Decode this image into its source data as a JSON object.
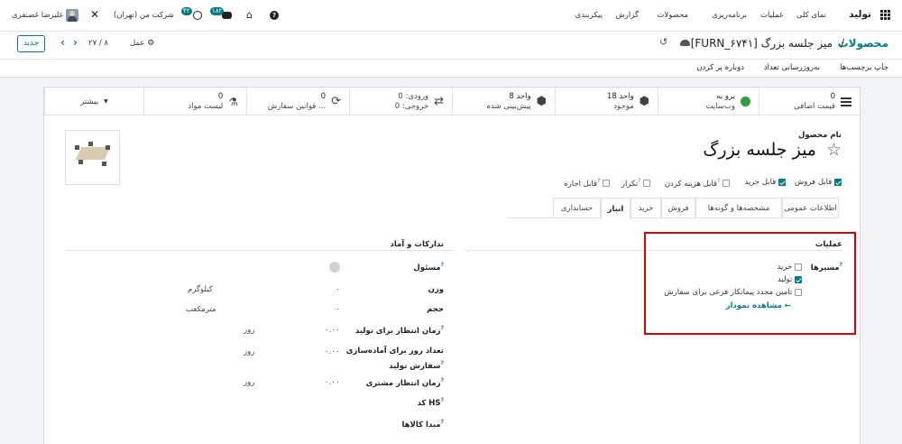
{
  "topnav": {
    "app_name": "تولید",
    "menu": [
      "نمای کلی",
      "عملیات",
      "برنامه‌ریزی",
      "محصولات",
      "گزارش",
      "پیکربندی"
    ],
    "user": "علیرضا غضنفری",
    "company": "شرکت من (تهران)",
    "activity_count": "۴۲",
    "messages_count": "۱۸۲"
  },
  "control_panel": {
    "breadcrumb_parent": "محصولات",
    "breadcrumb_sep": "/",
    "record_title": "[FURN_۶۷۴۱] میز جلسه بزرگ",
    "new_button": "جدید",
    "pager": "۸ / ۲۷",
    "action_label": "عمل"
  },
  "action_bar": {
    "buttons": [
      "چاپ برچسب‌ها",
      "به‌روزرسانی تعداد",
      "دوباره پر کردن"
    ]
  },
  "smart_buttons": [
    {
      "value": "0",
      "label": "قیمت اضافی",
      "icon": "list-icon"
    },
    {
      "value": "برو به",
      "label": "وب‌سایت",
      "icon": "globe-icon"
    },
    {
      "value": "18 واحد",
      "label": "موجود",
      "icon": "cubes-icon"
    },
    {
      "value": "8 واحد",
      "label": "پیش‌بینی شده",
      "icon": "cubes-icon"
    },
    {
      "value": "ورودی:  0",
      "label": "خروجی:  0",
      "icon": "exchange-icon"
    },
    {
      "value": "0",
      "label": "قوانین سفارش ...",
      "icon": "refresh-icon"
    },
    {
      "value": "0",
      "label": "لیست مواد",
      "icon": "flask-icon"
    },
    {
      "value": "",
      "label": "بیشتر",
      "icon": "caret-down-icon"
    }
  ],
  "product": {
    "name_label": "نام محصول",
    "name": "میز جلسه بزرگ",
    "flags": [
      {
        "label": "قابل فروش",
        "checked": true
      },
      {
        "label": "قابل خرید",
        "checked": true
      },
      {
        "label": "قابل هزینه کردن",
        "checked": false
      },
      {
        "label": "تکرار",
        "checked": false
      },
      {
        "label": "قابل اجاره",
        "checked": false
      }
    ]
  },
  "tabs": [
    "اطلاعات عمومی",
    "مشخصه‌ها و گونه‌ها",
    "فروش",
    "خرید",
    "انبار",
    "حسابداری"
  ],
  "operations": {
    "title": "عملیات",
    "routes_label": "مسیرها",
    "routes": [
      {
        "label": "خرید",
        "checked": false
      },
      {
        "label": "تولید",
        "checked": true
      },
      {
        "label": "تامین مجدد پیمانکار فرعی برای سفارش",
        "checked": false
      }
    ],
    "diagram_link": "مشاهده نمودار"
  },
  "logistics": {
    "title": "تدارکات و آماد",
    "responsible_label": "مسئول",
    "weight_label": "وزن",
    "weight_value": "۰",
    "weight_unit": "کیلوگرم",
    "volume_label": "حجم",
    "volume_value": "۰",
    "volume_unit": "مترمکعب",
    "mfg_lead_label": "زمان انتظار برای تولید",
    "mfg_lead_value": "۰.۰۰",
    "mfg_lead_unit": "روز",
    "prep_label_1": "تعداد روز برای آماده‌سازی",
    "prep_label_2": "سفارش تولید",
    "prep_value": "۰.۰۰",
    "prep_unit": "روز",
    "cust_lead_label": "زمان انتظار مشتری",
    "cust_lead_value": "۰.۰۰",
    "cust_lead_unit": "روز",
    "hs_label": "کد HS",
    "origin_label": "مبدا کالاها"
  }
}
